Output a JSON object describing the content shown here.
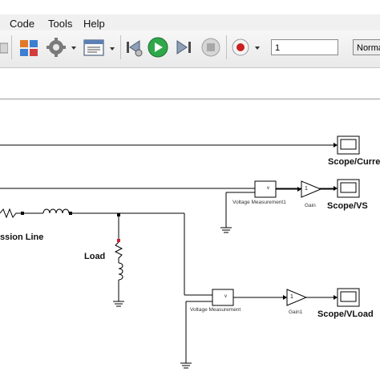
{
  "menubar": {
    "items": [
      "Code",
      "Tools",
      "Help"
    ]
  },
  "toolbar": {
    "stop_time": "1",
    "sim_mode": "Normal",
    "icons": [
      "home-icon",
      "library-browser-icon",
      "settings-gear-icon",
      "model-config-icon",
      "step-back-icon",
      "run-icon",
      "step-forward-icon",
      "stop-icon",
      "record-icon"
    ]
  },
  "diagram": {
    "labels": {
      "transmission_line": "ssion Line",
      "load": "Load",
      "vm1": "Voltage Measurement1",
      "vm": "Voltage Measurement",
      "gain": "Gain",
      "gain1": "Gain1",
      "scope_current": "Scope/Current",
      "scope_vs": "Scope/VS",
      "scope_vload": "Scope/VLoad",
      "gain_value": "1",
      "v_port": "v"
    }
  },
  "colors": {
    "run": "#2ea84a",
    "record": "#cc1f1f",
    "wire": "#000000"
  }
}
